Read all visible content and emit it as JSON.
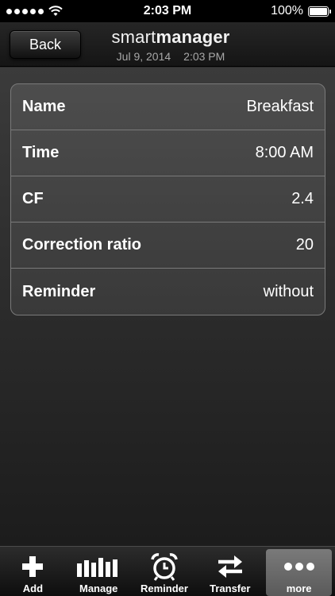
{
  "status_bar": {
    "time": "2:03 PM",
    "battery": "100%"
  },
  "nav": {
    "back_label": "Back",
    "title_light": "smart",
    "title_bold": "manager",
    "date": "Jul 9, 2014",
    "time": "2:03 PM"
  },
  "settings": [
    {
      "label": "Name",
      "value": "Breakfast"
    },
    {
      "label": "Time",
      "value": "8:00 AM"
    },
    {
      "label": "CF",
      "value": "2.4"
    },
    {
      "label": "Correction ratio",
      "value": "20"
    },
    {
      "label": "Reminder",
      "value": "without"
    }
  ],
  "tabs": [
    {
      "label": "Add",
      "icon": "plus-icon"
    },
    {
      "label": "Manage",
      "icon": "bars-icon"
    },
    {
      "label": "Reminder",
      "icon": "alarm-clock-icon"
    },
    {
      "label": "Transfer",
      "icon": "transfer-arrows-icon"
    },
    {
      "label": "more",
      "icon": "more-dots-icon"
    }
  ],
  "colors": {
    "background": "#2b2b2b",
    "row_background": "#444444",
    "row_border": "#7a7a7a",
    "active_tab": "#6a6a6a"
  }
}
